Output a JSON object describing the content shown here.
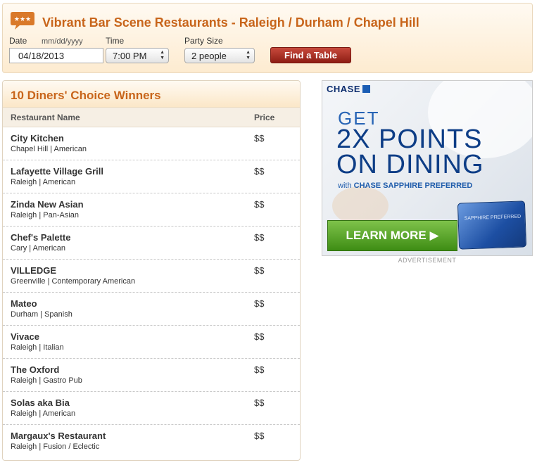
{
  "header": {
    "title": "Vibrant Bar Scene Restaurants - Raleigh / Durham / Chapel Hill",
    "logo_stars": "★★★"
  },
  "search": {
    "date_label": "Date",
    "date_format": "mm/dd/yyyy",
    "date_value": "04/18/2013",
    "time_label": "Time",
    "time_value": "7:00 PM",
    "party_label": "Party Size",
    "party_value": "2 people",
    "submit_label": "Find a Table"
  },
  "winners": {
    "title": "10 Diners' Choice Winners",
    "col_name": "Restaurant Name",
    "col_price": "Price",
    "rows": [
      {
        "name": "City Kitchen",
        "sub": "Chapel Hill | American",
        "price": "$$"
      },
      {
        "name": "Lafayette Village Grill",
        "sub": "Raleigh | American",
        "price": "$$"
      },
      {
        "name": "Zinda New Asian",
        "sub": "Raleigh | Pan-Asian",
        "price": "$$"
      },
      {
        "name": "Chef's Palette",
        "sub": "Cary | American",
        "price": "$$"
      },
      {
        "name": "VILLEDGE",
        "sub": "Greenville | Contemporary American",
        "price": "$$"
      },
      {
        "name": "Mateo",
        "sub": "Durham | Spanish",
        "price": "$$"
      },
      {
        "name": "Vivace",
        "sub": "Raleigh | Italian",
        "price": "$$"
      },
      {
        "name": "The Oxford",
        "sub": "Raleigh | Gastro Pub",
        "price": "$$"
      },
      {
        "name": "Solas aka Bia",
        "sub": "Raleigh | American",
        "price": "$$"
      },
      {
        "name": "Margaux's Restaurant",
        "sub": "Raleigh | Fusion / Eclectic",
        "price": "$$"
      }
    ]
  },
  "ad": {
    "brand": "CHASE",
    "get": "GET",
    "line1": "2X POINTS",
    "line2": "ON DINING",
    "with_prefix": "with",
    "with_card": "CHASE SAPPHIRE PREFERRED",
    "card_text": "SAPPHIRE PREFERRED",
    "cta": "LEARN MORE ▶",
    "label": "ADVERTISEMENT"
  },
  "colors": {
    "accent": "#c8651b",
    "button": "#a3281d",
    "ad_blue": "#0d3d86",
    "ad_green": "#5aa62e"
  }
}
